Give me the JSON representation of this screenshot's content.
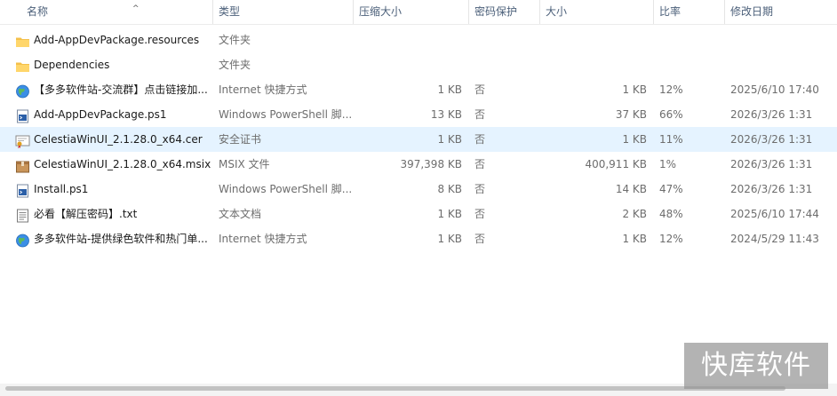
{
  "columns": {
    "name": "名称",
    "type": "类型",
    "compressed": "压缩大小",
    "password": "密码保护",
    "size": "大小",
    "ratio": "比率",
    "modified": "修改日期"
  },
  "rows": [
    {
      "icon": "folder-icon",
      "name": "Add-AppDevPackage.resources",
      "type": "文件夹",
      "compressed": "",
      "password": "",
      "size": "",
      "ratio": "",
      "modified": ""
    },
    {
      "icon": "folder-icon",
      "name": "Dependencies",
      "type": "文件夹",
      "compressed": "",
      "password": "",
      "size": "",
      "ratio": "",
      "modified": ""
    },
    {
      "icon": "internet-shortcut-icon",
      "name": "【多多软件站-交流群】点击链接加...",
      "type": "Internet 快捷方式",
      "compressed": "1 KB",
      "password": "否",
      "size": "1 KB",
      "ratio": "12%",
      "modified": "2025/6/10 17:40"
    },
    {
      "icon": "powershell-script-icon",
      "name": "Add-AppDevPackage.ps1",
      "type": "Windows PowerShell 脚...",
      "compressed": "13 KB",
      "password": "否",
      "size": "37 KB",
      "ratio": "66%",
      "modified": "2026/3/26 1:31"
    },
    {
      "icon": "certificate-icon",
      "name": "CelestiaWinUI_2.1.28.0_x64.cer",
      "type": "安全证书",
      "compressed": "1 KB",
      "password": "否",
      "size": "1 KB",
      "ratio": "11%",
      "modified": "2026/3/26 1:31",
      "selected": true
    },
    {
      "icon": "msix-package-icon",
      "name": "CelestiaWinUI_2.1.28.0_x64.msix",
      "type": "MSIX 文件",
      "compressed": "397,398 KB",
      "password": "否",
      "size": "400,911 KB",
      "ratio": "1%",
      "modified": "2026/3/26 1:31"
    },
    {
      "icon": "powershell-script-icon",
      "name": "Install.ps1",
      "type": "Windows PowerShell 脚...",
      "compressed": "8 KB",
      "password": "否",
      "size": "14 KB",
      "ratio": "47%",
      "modified": "2026/3/26 1:31"
    },
    {
      "icon": "text-document-icon",
      "name": "必看【解压密码】.txt",
      "type": "文本文档",
      "compressed": "1 KB",
      "password": "否",
      "size": "2 KB",
      "ratio": "48%",
      "modified": "2025/6/10 17:44"
    },
    {
      "icon": "internet-shortcut-icon",
      "name": "多多软件站-提供绿色软件和热门单...",
      "type": "Internet 快捷方式",
      "compressed": "1 KB",
      "password": "否",
      "size": "1 KB",
      "ratio": "12%",
      "modified": "2024/5/29 11:43"
    }
  ],
  "watermark": "快库软件",
  "colors": {
    "header_text": "#4c607a",
    "selected_row": "#e5f3ff",
    "folder": "#f4c04a"
  }
}
